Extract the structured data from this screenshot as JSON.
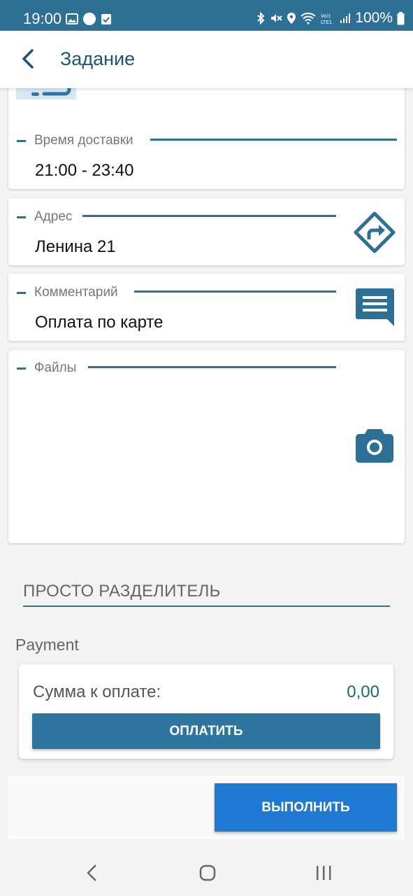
{
  "status_bar": {
    "time": "19:00",
    "battery": "100%",
    "icons": [
      "gallery-icon",
      "circle-icon",
      "check-icon",
      "bluetooth-icon",
      "mute-icon",
      "location-icon",
      "wifi-icon",
      "volte-icon",
      "signal-icon",
      "battery-icon"
    ]
  },
  "app_bar": {
    "title": "Задание",
    "back_icon": "chevron-left-icon"
  },
  "fields": {
    "delivery_time": {
      "label": "Время доставки",
      "value": "21:00 - 23:40"
    },
    "address": {
      "label": "Адрес",
      "value": "Ленина 21",
      "icon": "directions-icon"
    },
    "comment": {
      "label": "Комментарий",
      "value": "Оплата по карте",
      "icon": "comment-icon"
    },
    "files": {
      "label": "Файлы",
      "icon": "camera-icon"
    }
  },
  "separator": {
    "title": "ПРОСТО РАЗДЕЛИТЕЛЬ"
  },
  "payment": {
    "header": "Payment",
    "amount_label": "Сумма к оплате:",
    "amount_value": "0,00",
    "pay_button": "ОПЛАТИТЬ"
  },
  "actions": {
    "execute_button": "ВЫПОЛНИТЬ"
  },
  "colors": {
    "primary": "#2e6f96",
    "accent": "#1f78d1",
    "amount": "#1a6c6a"
  }
}
